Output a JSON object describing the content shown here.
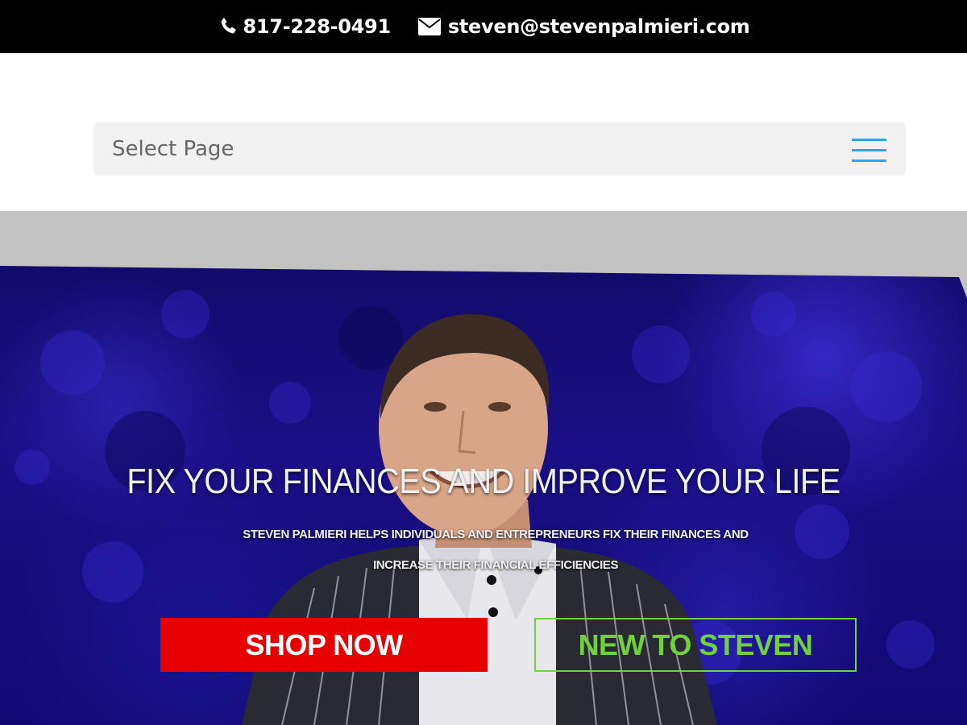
{
  "topbar": {
    "phone": "817-228-0491",
    "email": "steven@stevenpalmieri.com"
  },
  "nav": {
    "select_label": "Select Page",
    "menu_icon": "hamburger-menu-icon"
  },
  "hero": {
    "headline": "FIX YOUR FINANCES AND IMPROVE YOUR LIFE",
    "subline_1": "STEVEN PALMIERI HELPS INDIVIDUALS AND ENTREPRENEURS FIX THEIR FINANCES AND",
    "subline_2": "INCREASE THEIR FINANCIAL EFFICIENCIES",
    "shop_label": "SHOP NOW",
    "new_label": "NEW TO STEVEN"
  },
  "colors": {
    "accent_blue": "#2ea3f2",
    "shop_red": "#e60000",
    "new_green": "#6fd23a",
    "hero_blue": "#1a0f86"
  }
}
